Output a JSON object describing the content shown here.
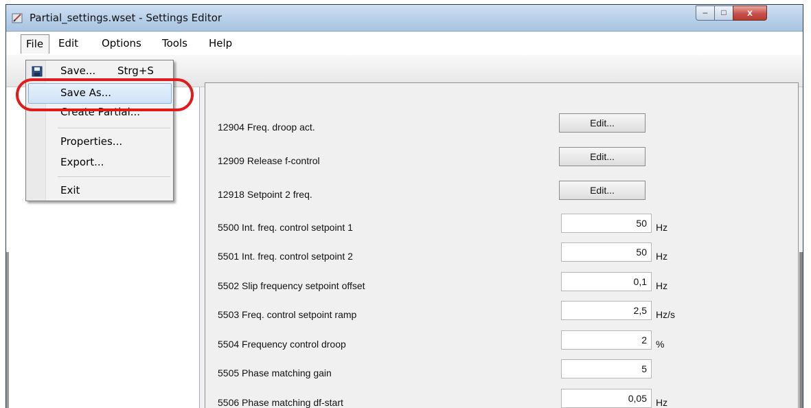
{
  "window": {
    "title": "Partial_settings.wset - Settings Editor",
    "controls": {
      "minimize": "–",
      "maximize": "□",
      "close": "x"
    }
  },
  "menu": {
    "items": [
      "File",
      "Edit",
      "Options",
      "Tools",
      "Help"
    ]
  },
  "file_menu": {
    "save": "Save...",
    "save_shortcut": "Strg+S",
    "save_as": "Save As...",
    "create_partial": "Create Partial...",
    "properties": "Properties...",
    "export": "Export...",
    "exit": "Exit"
  },
  "settings": [
    {
      "label": "12904 Freq. droop act.",
      "button": "Edit..."
    },
    {
      "label": "12909 Release f-control",
      "button": "Edit..."
    },
    {
      "label": "12918 Setpoint 2 freq.",
      "button": "Edit..."
    },
    {
      "label": "5500 Int. freq. control setpoint 1",
      "value": "50",
      "unit": "Hz"
    },
    {
      "label": "5501 Int. freq. control setpoint 2",
      "value": "50",
      "unit": "Hz"
    },
    {
      "label": "5502 Slip frequency setpoint offset",
      "value": "0,1",
      "unit": "Hz"
    },
    {
      "label": "5503 Freq. control setpoint ramp",
      "value": "2,5",
      "unit": "Hz/s"
    },
    {
      "label": "5504 Frequency control droop",
      "value": "2",
      "unit": "%"
    },
    {
      "label": "5505 Phase matching gain",
      "value": "5",
      "unit": ""
    },
    {
      "label": "5506 Phase matching df-start",
      "value": "0,05",
      "unit": "Hz"
    }
  ],
  "colors": {
    "highlight_circle": "#e11a1a",
    "menu_highlight": "#cfe3f7"
  }
}
